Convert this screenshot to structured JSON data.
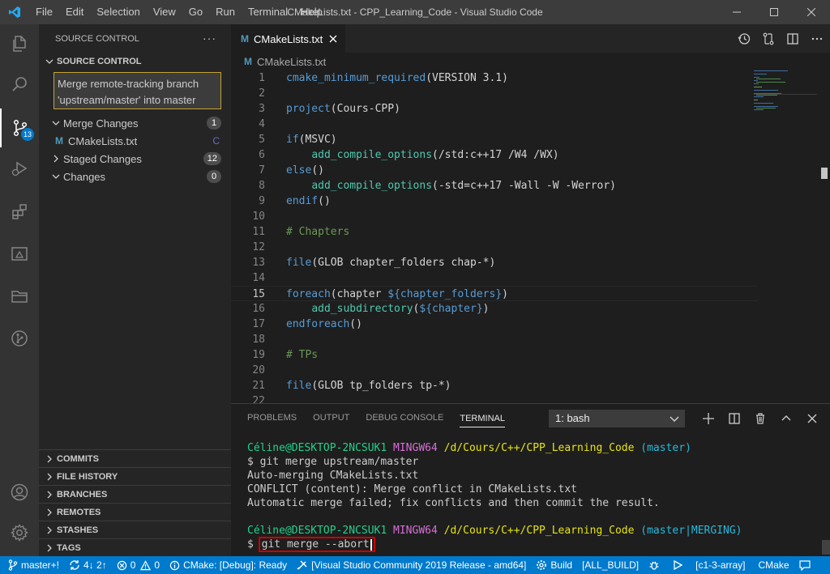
{
  "window": {
    "title": "CMakeLists.txt - CPP_Learning_Code - Visual Studio Code"
  },
  "menu": [
    "File",
    "Edit",
    "Selection",
    "View",
    "Go",
    "Run",
    "Terminal",
    "Help"
  ],
  "activity_bar": {
    "scm_badge": "13"
  },
  "sidebar": {
    "header": "SOURCE CONTROL",
    "more": "···",
    "section_title": "SOURCE CONTROL",
    "commit_message": "Merge remote-tracking branch 'upstream/master' into master",
    "groups": [
      {
        "label": "Merge Changes",
        "count": "1"
      },
      {
        "label": "Staged Changes",
        "count": "12"
      },
      {
        "label": "Changes",
        "count": "0"
      }
    ],
    "merge_file": {
      "icon_letter": "M",
      "name": "CMakeLists.txt",
      "status": "C"
    },
    "bottom_sections": [
      "COMMITS",
      "FILE HISTORY",
      "BRANCHES",
      "REMOTES",
      "STASHES",
      "TAGS"
    ]
  },
  "editor": {
    "tab_label": "CMakeLists.txt",
    "tab_icon_letter": "M",
    "breadcrumb": "CMakeLists.txt",
    "current_line": 15,
    "lines": [
      {
        "n": "1",
        "text": "cmake_minimum_required(VERSION 3.1)"
      },
      {
        "n": "2",
        "text": ""
      },
      {
        "n": "3",
        "text": "project(Cours-CPP)"
      },
      {
        "n": "4",
        "text": ""
      },
      {
        "n": "5",
        "text": "if(MSVC)"
      },
      {
        "n": "6",
        "text": "    add_compile_options(/std:c++17 /W4 /WX)"
      },
      {
        "n": "7",
        "text": "else()"
      },
      {
        "n": "8",
        "text": "    add_compile_options(-std=c++17 -Wall -W -Werror)"
      },
      {
        "n": "9",
        "text": "endif()"
      },
      {
        "n": "10",
        "text": ""
      },
      {
        "n": "11",
        "text": "# Chapters"
      },
      {
        "n": "12",
        "text": ""
      },
      {
        "n": "13",
        "text": "file(GLOB chapter_folders chap-*)"
      },
      {
        "n": "14",
        "text": ""
      },
      {
        "n": "15",
        "text": "foreach(chapter ${chapter_folders})"
      },
      {
        "n": "16",
        "text": "    add_subdirectory(${chapter})"
      },
      {
        "n": "17",
        "text": "endforeach()"
      },
      {
        "n": "18",
        "text": ""
      },
      {
        "n": "19",
        "text": "# TPs"
      },
      {
        "n": "20",
        "text": ""
      },
      {
        "n": "21",
        "text": "file(GLOB tp_folders tp-*)"
      },
      {
        "n": "22",
        "text": ""
      }
    ]
  },
  "panel": {
    "tabs": [
      "PROBLEMS",
      "OUTPUT",
      "DEBUG CONSOLE",
      "TERMINAL"
    ],
    "active_tab": "TERMINAL",
    "terminal_selector": "1: bash",
    "terminal": {
      "prompt1": {
        "user": "Céline@DESKTOP-2NCSUK1",
        "env": "MINGW64",
        "path": "/d/Cours/C++/CPP_Learning_Code",
        "branch": "(master)"
      },
      "cmd1": "$ git merge upstream/master",
      "out1": "Auto-merging CMakeLists.txt",
      "out2": "CONFLICT (content): Merge conflict in CMakeLists.txt",
      "out3": "Automatic merge failed; fix conflicts and then commit the result.",
      "prompt2": {
        "user": "Céline@DESKTOP-2NCSUK1",
        "env": "MINGW64",
        "path": "/d/Cours/C++/CPP_Learning_Code",
        "branch": "(master|MERGING)"
      },
      "cmd2_prefix": "$ ",
      "cmd2": "git merge --abort"
    }
  },
  "statusbar": {
    "branch": "master+!",
    "sync": "4↓ 2↑",
    "errors": "0",
    "warnings": "0",
    "cmake_status": "CMake: [Debug]: Ready",
    "kit": "[Visual Studio Community 2019 Release - amd64]",
    "build": "Build",
    "target": "[ALL_BUILD]",
    "launch_target": "[c1-3-array]",
    "language": "CMake"
  }
}
